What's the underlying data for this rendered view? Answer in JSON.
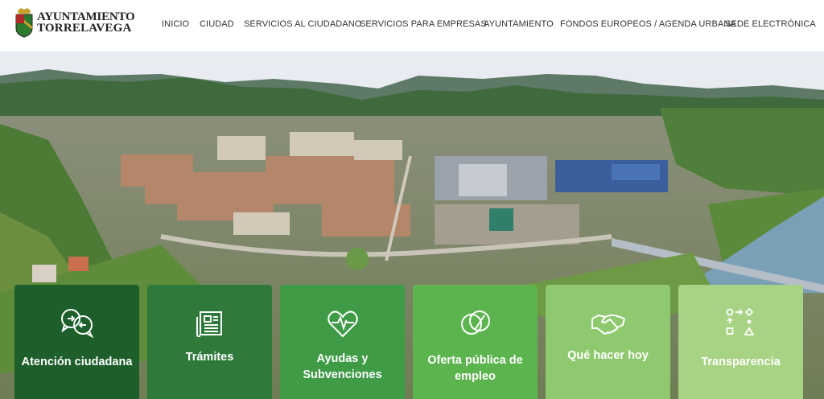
{
  "logo": {
    "line1": "AYUNTAMIENTO",
    "line2": "TORRELAVEGA"
  },
  "nav": [
    {
      "label": "INICIO"
    },
    {
      "label": "CIUDAD"
    },
    {
      "label": "SERVICIOS AL CIUDADANO"
    },
    {
      "label": "SERVICIOS PARA EMPRESAS"
    },
    {
      "label": "AYUNTAMIENTO"
    },
    {
      "label": "FONDOS EUROPEOS / AGENDA URBANA"
    },
    {
      "label": "SEDE ELECTRÓNICA"
    }
  ],
  "cards": [
    {
      "label": "Atención ciudadana",
      "icon": "chat-bubbles-icon",
      "color": "#1d5e2b"
    },
    {
      "label": "Trámites",
      "icon": "document-icon",
      "color": "#2f7a3a"
    },
    {
      "label": "Ayudas y Subvenciones",
      "icon": "heart-pulse-icon",
      "color": "#3f9b45"
    },
    {
      "label": "Oferta pública de empleo",
      "icon": "coins-icon",
      "color": "#5cb44e"
    },
    {
      "label": "Qué hacer hoy",
      "icon": "handshake-icon",
      "color": "#8fc96f"
    },
    {
      "label": "Transparencia",
      "icon": "shapes-icon",
      "color": "#a8d384"
    }
  ]
}
